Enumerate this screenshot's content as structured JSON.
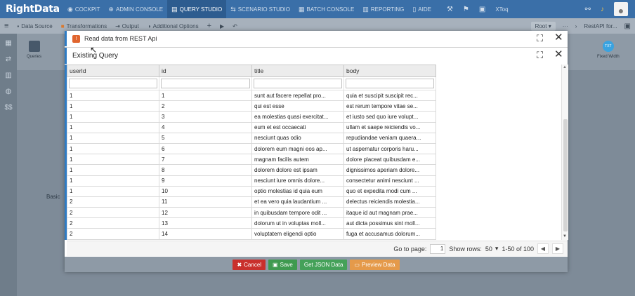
{
  "app": {
    "logo": "RightData",
    "nav": [
      {
        "label": "COCKPIT",
        "icon": "gauge-icon",
        "glyph": "◉"
      },
      {
        "label": "ADMIN CONSOLE",
        "icon": "admin-icon",
        "glyph": "⊕"
      },
      {
        "label": "QUERY STUDIO",
        "icon": "query-icon",
        "glyph": "▤"
      },
      {
        "label": "SCENARIO STUDIO",
        "icon": "scenario-icon",
        "glyph": "⇆"
      },
      {
        "label": "BATCH CONSOLE",
        "icon": "batch-icon",
        "glyph": "▦"
      },
      {
        "label": "REPORTING",
        "icon": "report-icon",
        "glyph": "▥"
      },
      {
        "label": "AIDE",
        "icon": "aide-icon",
        "glyph": "▯"
      }
    ],
    "tools_label": "XToq"
  },
  "toolbar": {
    "data_source": "Data Source",
    "transformations": "Transformations",
    "output": "Output",
    "additional_options": "Additional Options",
    "root_label": "Root",
    "breadcrumb": "RestAPI for..."
  },
  "palette": {
    "queries": "Queries",
    "fixed_width": "Fixed Width",
    "fixed_width_badge": "TXT"
  },
  "canvas": {
    "label": "Basic"
  },
  "outer_modal": {
    "badge": "!",
    "title": "Read data from REST Api",
    "buttons": {
      "cancel": "Cancel",
      "save": "Save",
      "json": "Get JSON Data",
      "preview": "Preview Data"
    }
  },
  "inner_modal": {
    "title": "Existing Query"
  },
  "grid": {
    "columns": [
      "userId",
      "id",
      "title",
      "body"
    ],
    "rows": [
      [
        "1",
        "1",
        "sunt aut facere repellat pro...",
        "quia et suscipit suscipit rec..."
      ],
      [
        "1",
        "2",
        "qui est esse",
        "est rerum tempore vitae se..."
      ],
      [
        "1",
        "3",
        "ea molestias quasi exercitat...",
        "et iusto sed quo iure volupt..."
      ],
      [
        "1",
        "4",
        "eum et est occaecati",
        "ullam et saepe reiciendis vo..."
      ],
      [
        "1",
        "5",
        "nesciunt quas odio",
        "repudiandae veniam quaera..."
      ],
      [
        "1",
        "6",
        "dolorem eum magni eos ap...",
        "ut aspernatur corporis haru..."
      ],
      [
        "1",
        "7",
        "magnam facilis autem",
        "dolore placeat quibusdam e..."
      ],
      [
        "1",
        "8",
        "dolorem dolore est ipsam",
        "dignissimos aperiam dolore..."
      ],
      [
        "1",
        "9",
        "nesciunt iure omnis dolore...",
        "consectetur animi nesciunt ..."
      ],
      [
        "1",
        "10",
        "optio molestias id quia eum",
        "quo et expedita modi cum ..."
      ],
      [
        "2",
        "11",
        "et ea vero quia laudantium ...",
        "delectus reiciendis molestia..."
      ],
      [
        "2",
        "12",
        "in quibusdam tempore odit ...",
        "itaque id aut magnam prae..."
      ],
      [
        "2",
        "13",
        "dolorum ut in voluptas moll...",
        "aut dicta possimus sint moll..."
      ],
      [
        "2",
        "14",
        "voluptatem eligendi optio",
        "fuga et accusamus dolorum..."
      ]
    ]
  },
  "pager": {
    "goto_label": "Go to page:",
    "page_value": "1",
    "rows_label": "Show rows:",
    "rows_value": "50",
    "range": "1-50 of 100"
  }
}
